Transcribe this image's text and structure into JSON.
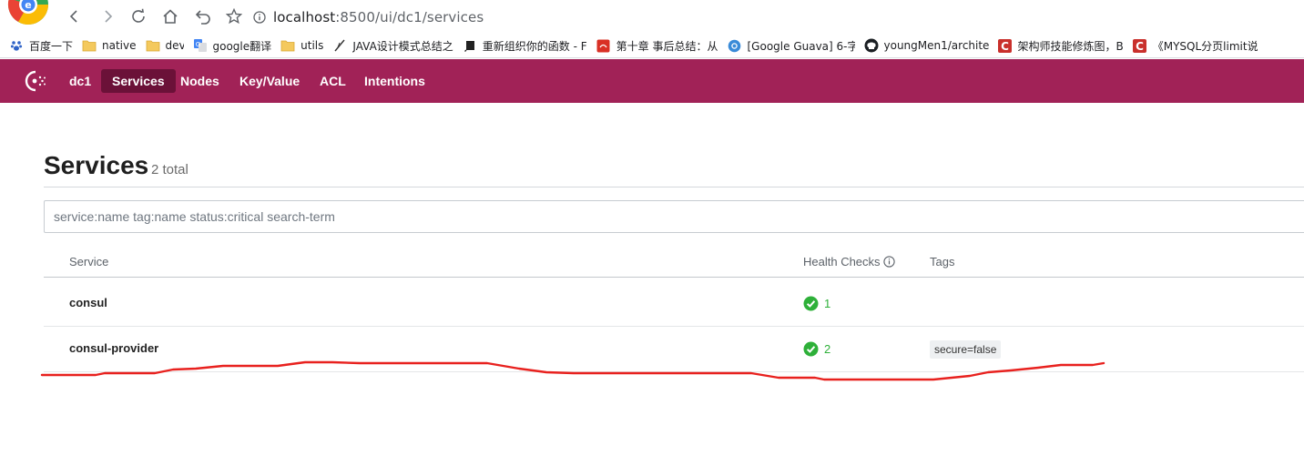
{
  "browser": {
    "url_host": "localhost",
    "url_rest": ":8500/ui/dc1/services",
    "bookmarks": [
      {
        "label": "百度一下",
        "icon": "paw-icon",
        "width": 0
      },
      {
        "label": "native",
        "icon": "folder-icon"
      },
      {
        "label": "dev",
        "icon": "folder-icon"
      },
      {
        "label": "google翻译",
        "icon": "translate-icon"
      },
      {
        "label": "utils",
        "icon": "folder-icon"
      },
      {
        "label": "JAVA设计模式总结之",
        "icon": "quill-icon"
      },
      {
        "label": "重新组织你的函数 - F",
        "icon": "book-icon"
      },
      {
        "label": "第十章 事后总结：从",
        "icon": "red-book-icon"
      },
      {
        "label": "[Google Guava] 6-字",
        "icon": "gear-blue-icon"
      },
      {
        "label": "youngMen1/archite",
        "icon": "github-icon"
      },
      {
        "label": "架构师技能修炼图，B",
        "icon": "csdn-icon"
      },
      {
        "label": "《MYSQL分页limit说",
        "icon": "csdn-icon"
      }
    ]
  },
  "appbar": {
    "datacenter": "dc1",
    "nav": [
      "Services",
      "Nodes",
      "Key/Value",
      "ACL",
      "Intentions"
    ],
    "active": "Services",
    "color": "#a12257"
  },
  "page": {
    "title": "Services",
    "count": "2 total"
  },
  "search": {
    "placeholder": "service:name tag:name status:critical search-term"
  },
  "table": {
    "headers": {
      "service": "Service",
      "health": "Health Checks",
      "tags": "Tags"
    },
    "rows": [
      {
        "name": "consul",
        "passing": "1",
        "tags": []
      },
      {
        "name": "consul-provider",
        "passing": "2",
        "tags": [
          "secure=false"
        ]
      }
    ]
  }
}
